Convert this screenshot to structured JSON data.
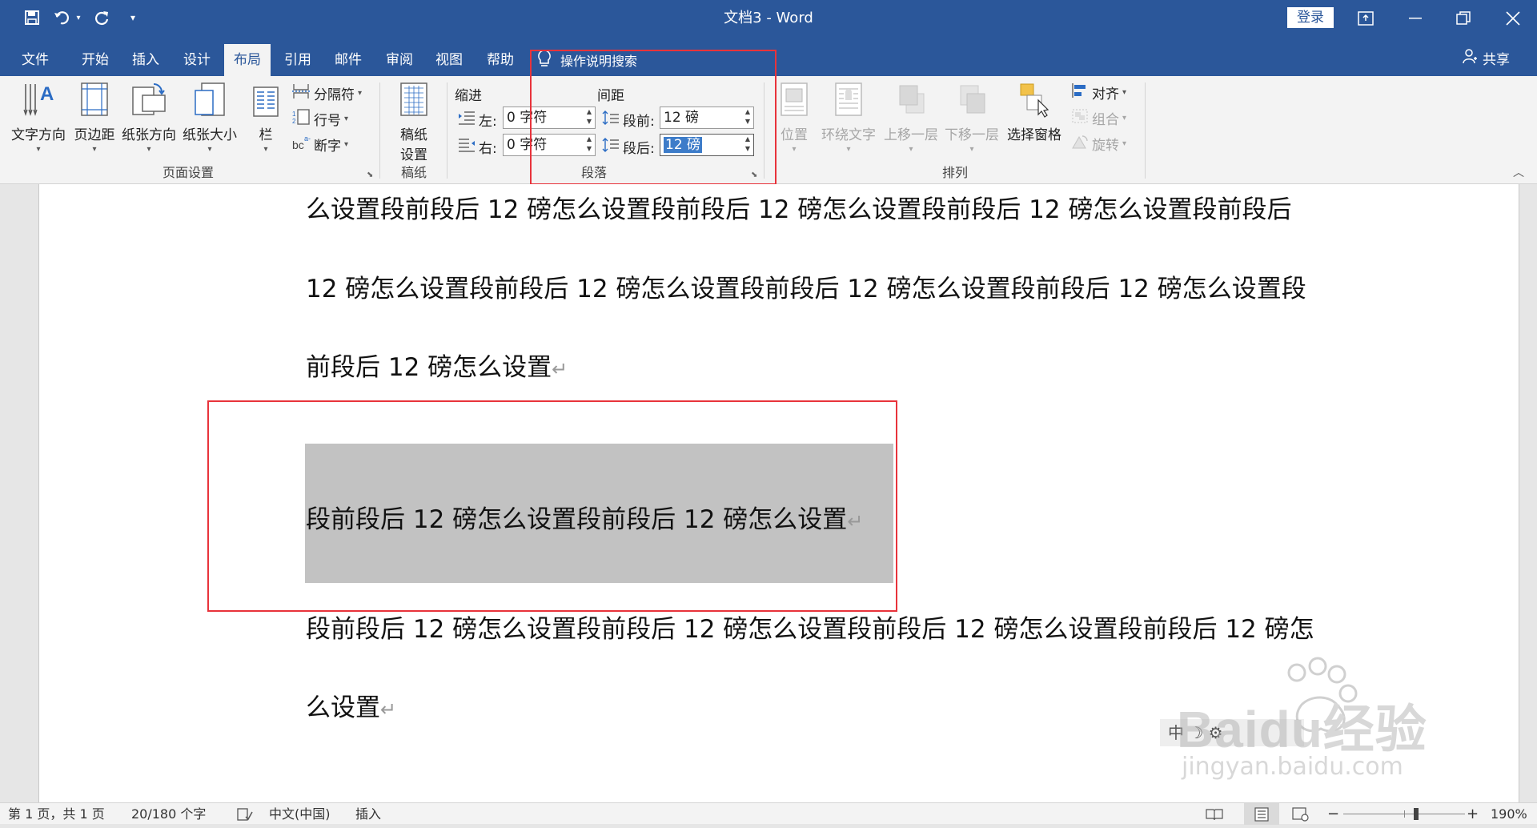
{
  "titlebar": {
    "title": "文档3  -  Word",
    "login_label": "登录",
    "save_icon": "save-icon",
    "undo_icon": "undo-icon",
    "redo_icon": "redo-icon"
  },
  "tabs": [
    {
      "label": "文件"
    },
    {
      "label": "开始"
    },
    {
      "label": "插入"
    },
    {
      "label": "设计"
    },
    {
      "label": "布局"
    },
    {
      "label": "引用"
    },
    {
      "label": "邮件"
    },
    {
      "label": "审阅"
    },
    {
      "label": "视图"
    },
    {
      "label": "帮助"
    }
  ],
  "tell_me": "操作说明搜索",
  "share_label": "共享",
  "ribbon": {
    "page_setup": {
      "label": "页面设置",
      "text_direction": "文字方向",
      "margins": "页边距",
      "orientation": "纸张方向",
      "size": "纸张大小",
      "columns": "栏",
      "breaks": "分隔符",
      "line_numbers": "行号",
      "hyphenation": "断字"
    },
    "draft": {
      "label": "稿纸",
      "setup": "稿纸设置",
      "setup_line1": "稿纸",
      "setup_line2": "设置"
    },
    "paragraph": {
      "label": "段落",
      "indent_title": "缩进",
      "spacing_title": "间距",
      "left_label": "左:",
      "left_value": "0 字符",
      "right_label": "右:",
      "right_value": "0 字符",
      "before_label": "段前:",
      "before_value": "12 磅",
      "after_label": "段后:",
      "after_value": "12 磅"
    },
    "arrange": {
      "label": "排列",
      "position": "位置",
      "wrap_text": "环绕文字",
      "bring_forward": "上移一层",
      "send_backward": "下移一层",
      "selection_pane": "选择窗格",
      "align": "对齐",
      "group": "组合",
      "rotate": "旋转"
    }
  },
  "document": {
    "lines": [
      "么设置段前段后 12 磅怎么设置段前段后 12 磅怎么设置段前段后 12 磅怎么设置段前段后",
      "12 磅怎么设置段前段后 12 磅怎么设置段前段后 12 磅怎么设置段前段后 12 磅怎么设置段",
      "前段后 12 磅怎么设置",
      "段前段后 12 磅怎么设置段前段后 12 磅怎么设置",
      "段前段后 12 磅怎么设置段前段后 12 磅怎么设置段前段后 12 磅怎么设置段前段后 12 磅怎",
      "么设置"
    ],
    "paragraph_mark": "↵",
    "ime_bar": "中 ☽ ⚙"
  },
  "statusbar": {
    "page": "第 1 页，共 1 页",
    "words": "20/180 个字",
    "language": "中文(中国)",
    "mode": "插入",
    "zoom": "190%"
  },
  "watermark": {
    "brand": "Baidu经验",
    "url": "jingyan.baidu.com"
  },
  "colors": {
    "accent": "#2b579a",
    "highlight": "#e8333b",
    "selection": "#c2c2c2"
  }
}
